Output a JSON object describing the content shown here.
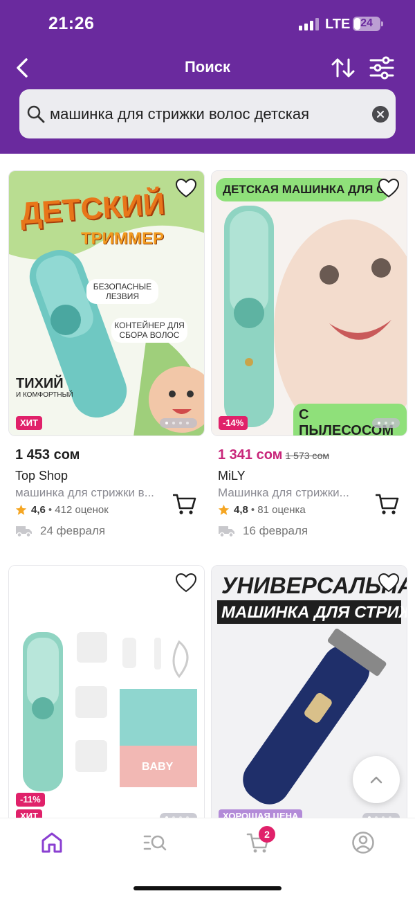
{
  "status_bar": {
    "time": "21:26",
    "network": "LTE",
    "battery": "24",
    "battery_level": 0.24
  },
  "nav": {
    "title": "Поиск",
    "icons": [
      "chevron-left-icon",
      "sort-arrows-icon",
      "filter-sliders-icon"
    ]
  },
  "search": {
    "value": "машинка для стрижки волос детская",
    "icon": "search-icon",
    "clear_icon": "clear-icon"
  },
  "products": [
    {
      "image_texts": [
        "ДЕТСКИЙ",
        "ТРИММЕР",
        "БЕЗОПАСНЫЕ ЛЕЗВИЯ",
        "КОНТЕЙНЕР ДЛЯ СБОРА ВОЛОС",
        "ТИХИЙ",
        "И КОМФОРТНЫЙ"
      ],
      "badge": "ХИТ",
      "price": "1 453 сом",
      "seller": "Top Shop",
      "name": "машинка для стрижки в...",
      "rating": "4,6",
      "reviews": "• 412 оценок",
      "delivery": "24 февраля"
    },
    {
      "image_texts": [
        "ДЕТСКАЯ МАШИНКА ДЛЯ СТРИЖ",
        "С ПЫЛЕСОСОМ"
      ],
      "badge": "-14%",
      "price": "1 341 сом",
      "old_price": "1 573 сом",
      "seller": "MiLY",
      "name": "Машинка для стрижки...",
      "rating": "4,8",
      "reviews": "• 81 оценка",
      "delivery": "16 февраля"
    },
    {
      "image_texts": [
        "BABY"
      ],
      "badges": [
        "-11%",
        "ХИТ"
      ]
    },
    {
      "image_texts": [
        "УНИВЕРСАЛЬНАЯ",
        "МАШИНКА ДЛЯ СТРИЖКИ"
      ],
      "badge": "ХОРОШАЯ ЦЕНА"
    }
  ],
  "tabbar": {
    "items": [
      "home-icon",
      "catalog-search-icon",
      "cart-icon",
      "profile-icon"
    ],
    "cart_count": "2"
  },
  "colors": {
    "header": "#6a2a9e",
    "accent": "#8a3fd1",
    "discount": "#e0216a",
    "price_sale": "#c8267a"
  }
}
